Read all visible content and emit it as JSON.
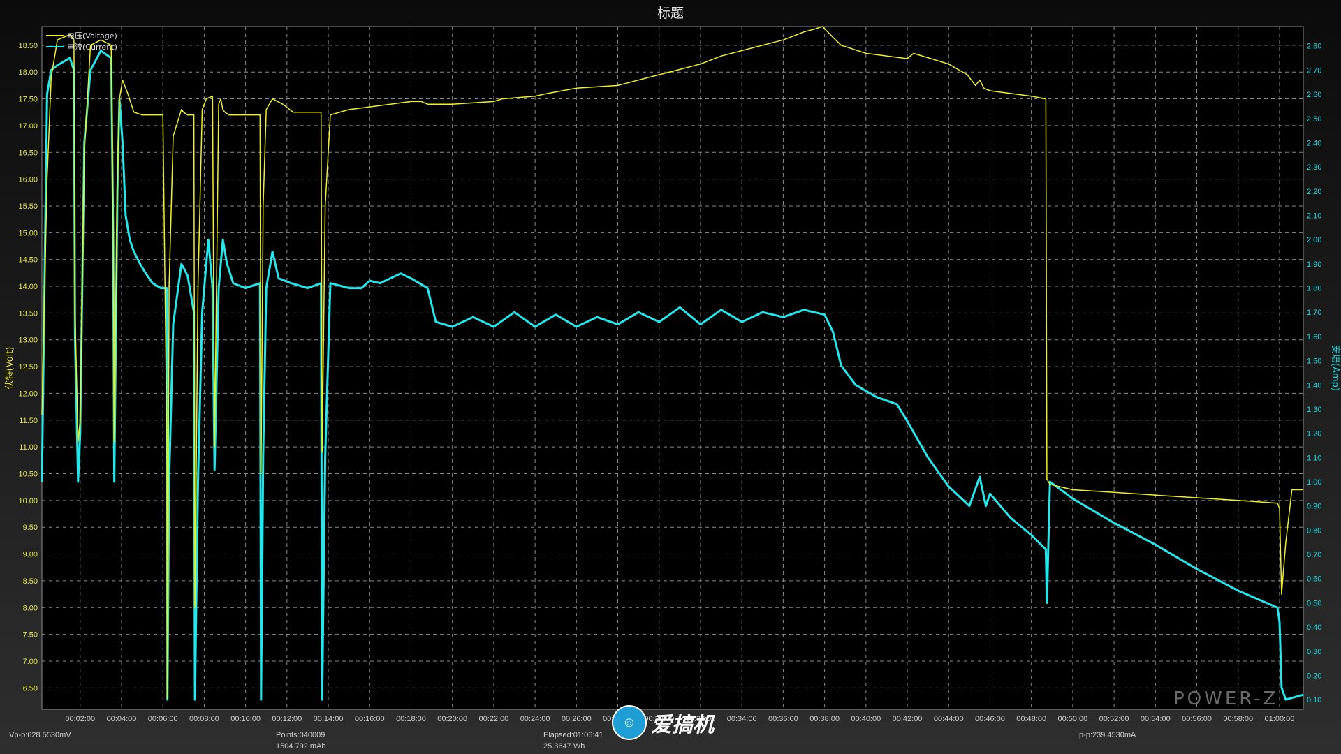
{
  "chart_data": {
    "type": "line",
    "title": "标题",
    "ylabel": "伏特(Volt)",
    "y2label": "安培(Amp)",
    "legend": [
      "电压(Voltage)",
      "电流(Current)"
    ],
    "legend_position": "top-left",
    "grid": true,
    "x_ticks": [
      "00:02:00",
      "00:04:00",
      "00:06:00",
      "00:08:00",
      "00:10:00",
      "00:12:00",
      "00:14:00",
      "00:16:00",
      "00:18:00",
      "00:20:00",
      "00:22:00",
      "00:24:00",
      "00:26:00",
      "00:28:00",
      "00:30:00",
      "00:32:00",
      "00:34:00",
      "00:36:00",
      "00:38:00",
      "00:40:00",
      "00:42:00",
      "00:44:00",
      "00:46:00",
      "00:48:00",
      "00:50:00",
      "00:52:00",
      "00:54:00",
      "00:56:00",
      "00:58:00",
      "01:00:00"
    ],
    "xlim_min": [
      0.15,
      61.15
    ],
    "y_ticks": [
      "6.50",
      "7.00",
      "7.50",
      "8.00",
      "8.50",
      "9.00",
      "9.50",
      "10.00",
      "10.50",
      "11.00",
      "11.50",
      "12.00",
      "12.50",
      "13.00",
      "13.50",
      "14.00",
      "14.50",
      "15.00",
      "15.50",
      "16.00",
      "16.50",
      "17.00",
      "17.50",
      "18.00",
      "18.50"
    ],
    "ylim": [
      6.1,
      18.85
    ],
    "y2_ticks": [
      "0.10",
      "0.20",
      "0.30",
      "0.40",
      "0.50",
      "0.60",
      "0.70",
      "0.80",
      "0.90",
      "1.00",
      "1.10",
      "1.20",
      "1.30",
      "1.40",
      "1.50",
      "1.60",
      "1.70",
      "1.80",
      "1.90",
      "2.00",
      "2.10",
      "2.20",
      "2.30",
      "2.40",
      "2.50",
      "2.60",
      "2.70",
      "2.80"
    ],
    "y2lim": [
      0.06,
      2.88
    ],
    "series": [
      {
        "name": "电压(Voltage)",
        "axis": "left",
        "color": "#f2f21a",
        "x": [
          0.15,
          0.4,
          0.6,
          0.9,
          1.5,
          1.7,
          1.75,
          1.9,
          2.0,
          2.2,
          2.5,
          3.0,
          3.5,
          3.6,
          3.65,
          3.8,
          3.9,
          4.05,
          4.3,
          4.6,
          5.0,
          5.3,
          5.6,
          6.0,
          6.2,
          6.22,
          6.3,
          6.5,
          6.9,
          7.0,
          7.2,
          7.5,
          7.55,
          7.7,
          7.9,
          8.1,
          8.4,
          8.5,
          8.7,
          8.8,
          8.9,
          9.0,
          9.2,
          9.6,
          10.0,
          10.7,
          10.75,
          10.85,
          11.0,
          11.3,
          11.8,
          12.3,
          12.9,
          13.65,
          13.7,
          13.85,
          14.1,
          15.0,
          16.0,
          17.0,
          18.0,
          18.5,
          18.8,
          20.0,
          22.0,
          22.4,
          24.0,
          24.6,
          26.0,
          28.0,
          29.0,
          30.0,
          31.0,
          32.0,
          33.0,
          34.0,
          35.0,
          36.0,
          37.0,
          37.5,
          37.9,
          38.4,
          38.8,
          40.0,
          42.0,
          42.3,
          44.0,
          44.9,
          45.3,
          45.5,
          45.7,
          46.0,
          47.0,
          48.0,
          48.7,
          48.75,
          48.9,
          50.0,
          52.0,
          54.0,
          56.0,
          58.0,
          59.9,
          60.0,
          60.1,
          60.3,
          60.6,
          61.0,
          61.15
        ],
        "y": [
          11.6,
          16.0,
          17.9,
          18.6,
          18.7,
          18.6,
          13.5,
          11.1,
          11.5,
          16.5,
          18.5,
          18.6,
          18.5,
          15.0,
          11.1,
          16.0,
          17.5,
          17.85,
          17.6,
          17.25,
          17.2,
          17.2,
          17.2,
          17.2,
          11.0,
          6.3,
          14.0,
          16.8,
          17.3,
          17.25,
          17.2,
          17.2,
          8.0,
          14.0,
          17.3,
          17.5,
          17.55,
          11.0,
          17.4,
          17.5,
          17.3,
          17.25,
          17.2,
          17.2,
          17.2,
          17.2,
          10.5,
          15.5,
          17.3,
          17.5,
          17.4,
          17.25,
          17.25,
          17.25,
          10.9,
          15.5,
          17.2,
          17.3,
          17.35,
          17.4,
          17.45,
          17.45,
          17.4,
          17.4,
          17.45,
          17.5,
          17.55,
          17.6,
          17.7,
          17.75,
          17.85,
          17.95,
          18.05,
          18.15,
          18.3,
          18.4,
          18.5,
          18.6,
          18.75,
          18.8,
          18.85,
          18.65,
          18.5,
          18.35,
          18.25,
          18.35,
          18.15,
          17.95,
          17.75,
          17.85,
          17.7,
          17.65,
          17.6,
          17.55,
          17.5,
          10.4,
          10.3,
          10.2,
          10.15,
          10.1,
          10.05,
          10.0,
          9.95,
          9.85,
          8.25,
          9.2,
          10.2,
          10.2,
          10.2
        ]
      },
      {
        "name": "电流(Current)",
        "axis": "right",
        "color": "#20e8ec",
        "x": [
          0.15,
          0.4,
          0.6,
          0.9,
          1.5,
          1.7,
          1.75,
          1.9,
          2.0,
          2.2,
          2.5,
          3.0,
          3.5,
          3.6,
          3.65,
          3.8,
          3.9,
          4.05,
          4.2,
          4.4,
          4.6,
          4.9,
          5.1,
          5.5,
          5.9,
          6.2,
          6.22,
          6.3,
          6.5,
          6.9,
          7.2,
          7.5,
          7.55,
          7.7,
          7.9,
          8.2,
          8.4,
          8.5,
          8.7,
          8.9,
          9.1,
          9.4,
          10.0,
          10.7,
          10.75,
          10.85,
          11.0,
          11.3,
          11.6,
          12.2,
          13.0,
          13.65,
          13.7,
          13.85,
          14.1,
          15.0,
          15.6,
          16.0,
          16.5,
          17.0,
          17.5,
          18.0,
          18.8,
          19.2,
          20.0,
          21.0,
          22.0,
          23.0,
          24.0,
          25.0,
          26.0,
          27.0,
          28.0,
          29.0,
          30.0,
          31.0,
          32.0,
          33.0,
          34.0,
          35.0,
          36.0,
          37.0,
          38.0,
          38.4,
          38.8,
          39.5,
          40.5,
          41.5,
          42.0,
          43.0,
          44.0,
          45.0,
          45.5,
          45.8,
          46.0,
          47.0,
          48.0,
          48.7,
          48.75,
          48.9,
          50.0,
          52.0,
          54.0,
          56.0,
          58.0,
          59.9,
          60.0,
          60.1,
          60.3,
          61.15
        ],
        "y": [
          1.0,
          2.6,
          2.7,
          2.72,
          2.75,
          2.7,
          1.6,
          1.0,
          1.2,
          2.4,
          2.7,
          2.78,
          2.75,
          2.0,
          1.0,
          2.2,
          2.58,
          2.4,
          2.1,
          2.0,
          1.95,
          1.9,
          1.87,
          1.82,
          1.8,
          1.8,
          0.1,
          1.0,
          1.65,
          1.9,
          1.85,
          1.7,
          0.1,
          1.0,
          1.7,
          2.0,
          1.8,
          1.05,
          1.8,
          2.0,
          1.9,
          1.82,
          1.8,
          1.82,
          0.1,
          1.1,
          1.8,
          1.95,
          1.84,
          1.82,
          1.8,
          1.82,
          0.1,
          1.1,
          1.82,
          1.8,
          1.8,
          1.83,
          1.82,
          1.84,
          1.86,
          1.84,
          1.8,
          1.66,
          1.64,
          1.68,
          1.64,
          1.7,
          1.64,
          1.69,
          1.64,
          1.68,
          1.65,
          1.7,
          1.66,
          1.72,
          1.65,
          1.71,
          1.66,
          1.7,
          1.68,
          1.71,
          1.69,
          1.62,
          1.48,
          1.4,
          1.35,
          1.32,
          1.25,
          1.1,
          0.98,
          0.9,
          1.02,
          0.9,
          0.95,
          0.85,
          0.78,
          0.72,
          0.5,
          1.0,
          0.93,
          0.83,
          0.74,
          0.64,
          0.55,
          0.48,
          0.42,
          0.15,
          0.1,
          0.12
        ]
      }
    ]
  },
  "stats": {
    "vpp": "Vp-p:628.5530mV",
    "points": "Points:040009",
    "capacity": "1504.792 mAh",
    "elapsed": "Elapsed:01:06:41",
    "energy": "25.3647 Wh",
    "ipp": "Ip-p:239.4530mA"
  },
  "watermark": "POWER-Z",
  "logo_text": "爱搞机"
}
